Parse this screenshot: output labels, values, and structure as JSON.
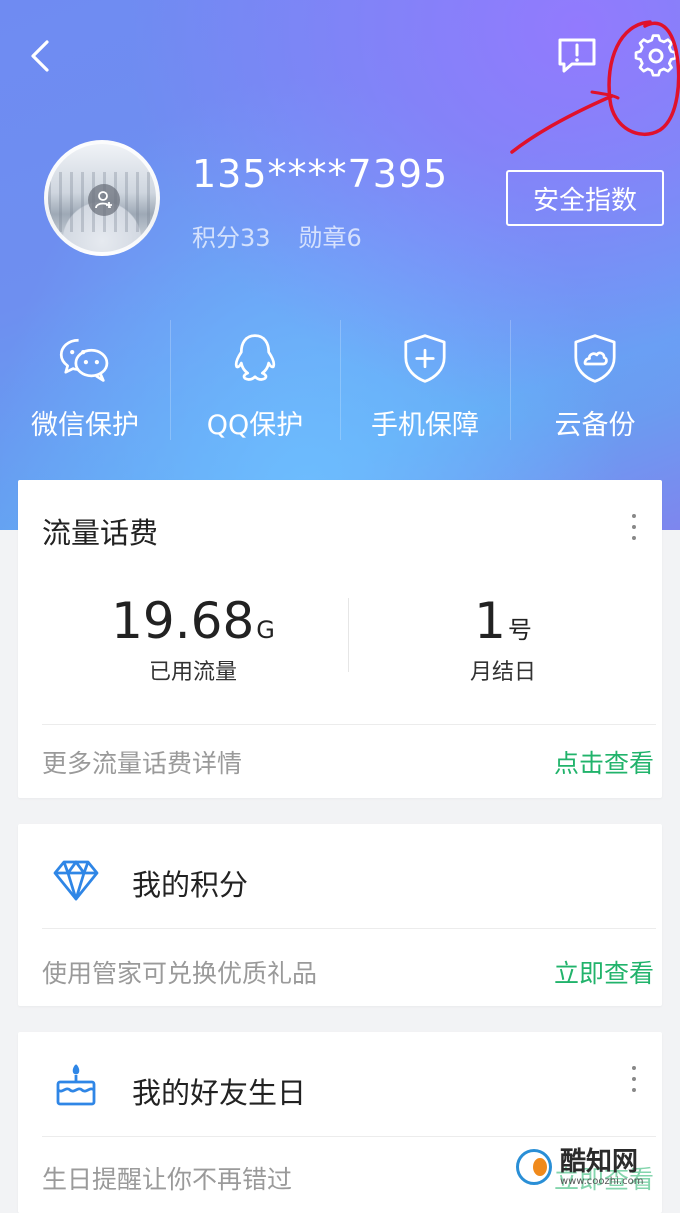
{
  "header": {
    "phone": "135****7395",
    "points_label": "积分33",
    "medals_label": "勋章6",
    "security_button": "安全指数"
  },
  "features": [
    {
      "label": "微信保护",
      "icon": "wechat-icon"
    },
    {
      "label": "QQ保护",
      "icon": "qq-penguin-icon"
    },
    {
      "label": "手机保障",
      "icon": "shield-plus-icon"
    },
    {
      "label": "云备份",
      "icon": "cloud-shield-icon"
    }
  ],
  "traffic_card": {
    "title": "流量话费",
    "used_value": "19.68",
    "used_unit": "G",
    "used_caption": "已用流量",
    "billing_value": "1",
    "billing_unit": "号",
    "billing_caption": "月结日",
    "footer_text": "更多流量话费详情",
    "footer_link": "点击查看"
  },
  "points_card": {
    "title": "我的积分",
    "footer_text": "使用管家可兑换优质礼品",
    "footer_link": "立即查看"
  },
  "birthday_card": {
    "title": "我的好友生日",
    "footer_text": "生日提醒让你不再错过",
    "footer_link": "立即查看"
  },
  "watermark": {
    "name": "酷知网",
    "url": "www.coozhi.com"
  },
  "colors": {
    "accent_green": "#21b36b",
    "icon_blue": "#2f86e6",
    "annotation_red": "#e0112b"
  }
}
